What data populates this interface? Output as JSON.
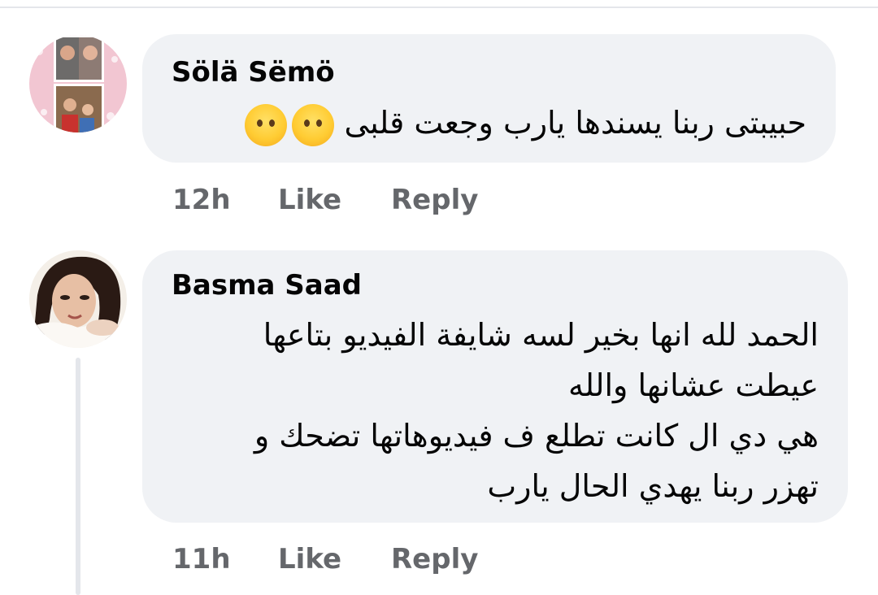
{
  "comments": [
    {
      "author": "Sölä Sëmö",
      "lines": [
        "حبيبتى ربنا يسندها يارب وجعت قلبى"
      ],
      "emoji": [
        "face-without-mouth-emoji",
        "face-without-mouth-emoji"
      ],
      "time": "12h",
      "like_label": "Like",
      "reply_label": "Reply"
    },
    {
      "author": "Basma Saad",
      "lines": [
        "الحمد لله انها بخير لسه شايفة الفيديو بتاعها",
        "عيطت عشانها والله",
        "هي دي ال كانت تطلع ف فيديوهاتها تضحك و",
        "تهزر ربنا يهدي الحال يارب"
      ],
      "time": "11h",
      "like_label": "Like",
      "reply_label": "Reply"
    }
  ],
  "colors": {
    "bubble": "#f0f2f5",
    "secondary_text": "#65676b",
    "primary_text": "#050505"
  }
}
